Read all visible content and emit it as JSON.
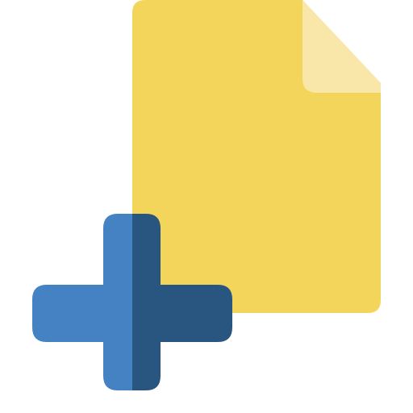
{
  "icon": {
    "name": "add-file-icon",
    "parts": [
      "document-icon",
      "plus-icon"
    ]
  },
  "colors": {
    "background": "#ffffff",
    "document_body": "#F3D55B",
    "document_fold": "#F9E7A9",
    "plus_left": "#4482C3",
    "plus_right": "#285680"
  }
}
